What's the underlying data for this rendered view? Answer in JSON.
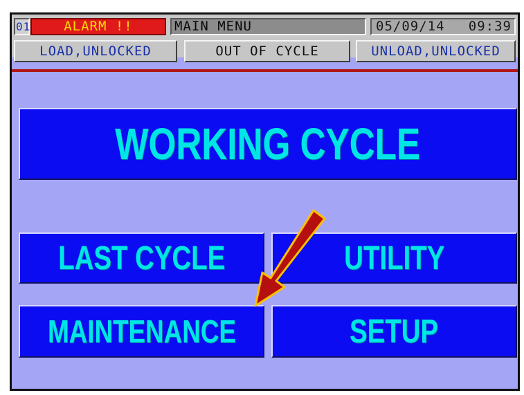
{
  "status_bar": {
    "station_number": "01",
    "alarm_text": "ALARM !!",
    "screen_title": "MAIN MENU",
    "date": "05/09/14",
    "time": "09:39",
    "load_status": "LOAD,UNLOCKED",
    "cycle_status": "OUT OF CYCLE",
    "unload_status": "UNLOAD,UNLOCKED"
  },
  "menu": {
    "working_cycle": "WORKING CYCLE",
    "last_cycle": "LAST CYCLE",
    "utility": "UTILITY",
    "maintenance": "MAINTENANCE",
    "setup": "SETUP"
  },
  "annotation": {
    "arrow_icon": "red-arrow-pointing-down-left"
  },
  "colors": {
    "background": "#a5a5f6",
    "button_face": "#0c0cf2",
    "button_text": "#00e6e6",
    "alarm_red": "#e01a1a",
    "alarm_text": "#ffdd00",
    "status_text": "#1a2fa8",
    "arrow": "#b41010"
  }
}
